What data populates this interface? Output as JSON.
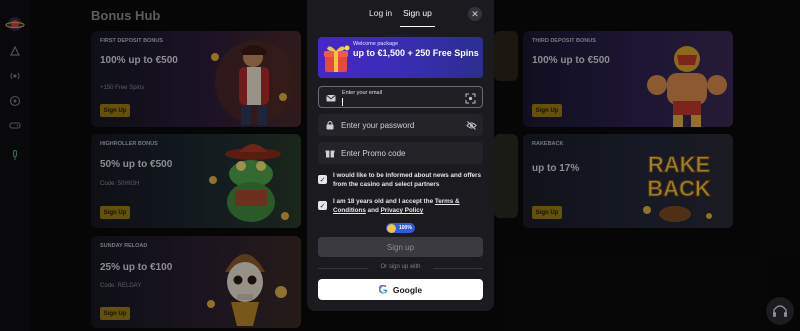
{
  "app": {
    "title": "Bonus Hub"
  },
  "rail": {
    "icons": [
      "logo-icon",
      "promo-icon",
      "live-icon",
      "sports-icon",
      "games-icon",
      "microphone-icon"
    ]
  },
  "cards": [
    {
      "tag": "FIRST DEPOSIT BONUS",
      "title": "100% up to €500",
      "sub": "+150 Free Spins",
      "button": "Sign Up"
    },
    {
      "tag": "THIRD DEPOSIT BONUS",
      "title": "100% up to €500",
      "sub": "",
      "button": "Sign Up"
    },
    {
      "tag": "HIGHROLLER BONUS",
      "title": "50% up to €500",
      "sub": "Code: 50HIGH",
      "button": "Sign Up"
    },
    {
      "tag": "RAKEBACK",
      "title": "up to 17%",
      "sub": "",
      "button": "Sign Up",
      "art_text": "RAKE BACK"
    },
    {
      "tag": "SUNDAY RELOAD",
      "title": "25% up to €100",
      "sub": "Code: RELDAY",
      "button": "Sign Up"
    }
  ],
  "modal": {
    "tabs": [
      {
        "label": "Log in",
        "active": false
      },
      {
        "label": "Sign up",
        "active": true
      }
    ],
    "close_icon": "close-icon",
    "promo": {
      "top": "Welcome package",
      "main": "up to €1,500 + 250 Free Spins"
    },
    "email": {
      "label": "Enter your email",
      "value": ""
    },
    "password": {
      "placeholder": "Enter your password"
    },
    "promo_code": {
      "placeholder": "Enter Promo code"
    },
    "checkbox_news": {
      "checked": true,
      "text": "I would like to be informed about news and offers from the casino and select partners"
    },
    "checkbox_terms": {
      "checked": true,
      "text_pre": "I am 18 years old and I accept the ",
      "terms_link": "Terms & Conditions",
      "text_mid": " and ",
      "privacy_link": "Privacy Policy"
    },
    "badge": "100%",
    "signup_button": "Sign up",
    "or_text": "Or sign up with",
    "google_button": "Google"
  },
  "colors": {
    "accent_gold": "#9a7d12",
    "promo_purple": "#4428c9",
    "modal_bg": "#1b1b1f"
  }
}
